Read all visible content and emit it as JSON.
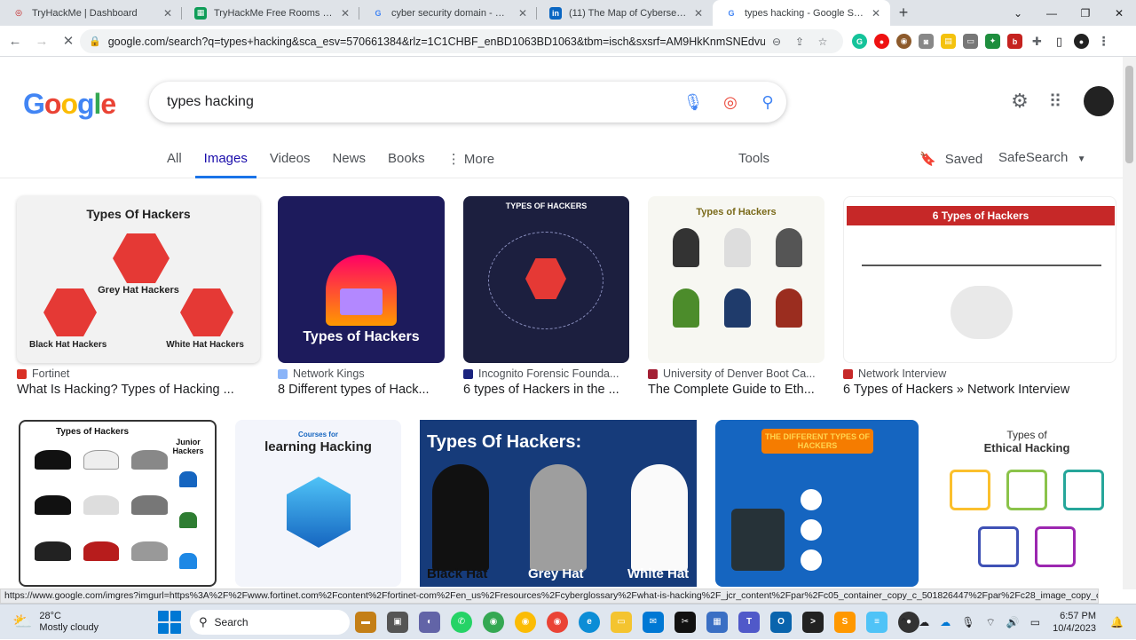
{
  "browser": {
    "tabs": [
      {
        "title": "TryHackMe | Dashboard",
        "favicon": "tryhackme-icon",
        "color": "#c11111",
        "active": false
      },
      {
        "title": "TryHackMe Free Rooms - Google",
        "favicon": "sheets-icon",
        "color": "#0f9d58",
        "active": false
      },
      {
        "title": "cyber security domain - Google",
        "favicon": "google-icon",
        "color": "#4285f4",
        "active": false
      },
      {
        "title": "(11) The Map of Cybersecurity D",
        "favicon": "linkedin-icon",
        "color": "#0a66c2",
        "active": false
      },
      {
        "title": "types hacking - Google Search",
        "favicon": "google-icon",
        "color": "#4285f4",
        "active": true
      }
    ],
    "new_tab_symbol": "+",
    "url": "google.com/search?q=types+hacking&sca_esv=570661384&rlz=1C1CHBF_enBD1063BD1063&tbm=isch&sxsrf=AM9HkKnmSNEdvuJM6EsShw..."
  },
  "search": {
    "query": "types hacking",
    "tabs": [
      "All",
      "Images",
      "Videos",
      "News",
      "Books",
      "More"
    ],
    "active_tab": "Images",
    "more_symbol": "⋮",
    "tools_label": "Tools",
    "saved_label": "Saved",
    "safesearch_label": "SafeSearch"
  },
  "results": [
    {
      "source": "Fortinet",
      "caption": "What Is Hacking? Types of Hacking ...",
      "image_title": "Types Of Hackers",
      "sub_a": "Grey Hat Hackers",
      "sub_b": "Black Hat Hackers",
      "sub_c": "White Hat Hackers",
      "bg": "#f2f2f2",
      "fg": "#222",
      "fav": "#d93025"
    },
    {
      "source": "Network Kings",
      "caption": "8 Different types of Hack...",
      "image_title": "Types of Hackers",
      "bg": "#1d1b5c",
      "fg": "#fff",
      "fav": "#8ab4f8"
    },
    {
      "source": "Incognito Forensic Founda...",
      "caption": "6 types of Hackers in the ...",
      "image_title": "TYPES OF HACKERS",
      "bg": "#1c1f3f",
      "fg": "#fff",
      "fav": "#1a237e"
    },
    {
      "source": "University of Denver Boot Ca...",
      "caption": "The Complete Guide to Eth...",
      "image_title": "Types of Hackers",
      "bg": "#f7f7f2",
      "fg": "#7a6a1a",
      "fav": "#a31f34"
    },
    {
      "source": "Network Interview",
      "caption": "6 Types of Hackers » Network Interview",
      "image_title": "6 Types of Hackers",
      "bg": "#ffffff",
      "fg": "#ffffff",
      "fav": "#c62828"
    },
    {
      "image_title": "Types of Hackers",
      "sub_a": "Junior Hackers",
      "bg": "#ffffff",
      "fg": "#111"
    },
    {
      "image_title": "learning Hacking",
      "sub_a": "Courses for",
      "bg": "#f3f5fb",
      "fg": "#222"
    },
    {
      "image_title": "Types Of Hackers:",
      "sub_a": "Black Hat",
      "sub_b": "Grey Hat",
      "sub_c": "White Hat",
      "bg": "#163b7a",
      "fg": "#fff"
    },
    {
      "image_title": "THE DIFFERENT TYPES OF HACKERS",
      "bg": "#1565c0",
      "fg": "#ffd54f"
    },
    {
      "image_title": "Ethical Hacking",
      "sub_a": "Types of",
      "bg": "#ffffff",
      "fg": "#333"
    }
  ],
  "status_url": "https://www.google.com/imgres?imgurl=https%3A%2F%2Fwww.fortinet.com%2Fcontent%2Ffortinet-com%2Fen_us%2Fresources%2Fcyberglossary%2Fwhat-is-hacking%2F_jcr_content%2Fpar%2Fc05_container_copy_c_501826447%2Fpar%2Fc28_image_copy_copy_.img.jpg%2F1...",
  "taskbar": {
    "temperature": "28°C",
    "weather": "Mostly cloudy",
    "search_label": "Search",
    "time": "6:57 PM",
    "date": "10/4/2023"
  }
}
